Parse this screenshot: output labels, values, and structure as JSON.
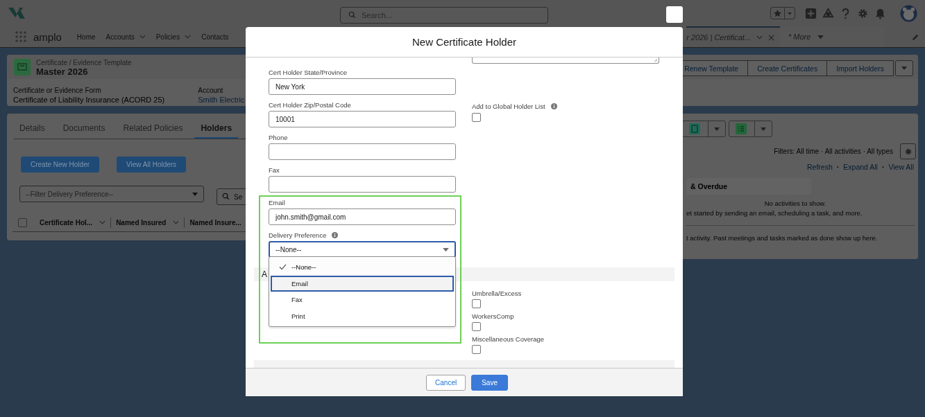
{
  "global_header": {
    "search_placeholder": "Search..."
  },
  "app_nav": {
    "app_name": "amplo",
    "items": [
      {
        "label": "Home",
        "has_menu": false
      },
      {
        "label": "Accounts",
        "has_menu": true
      },
      {
        "label": "Policies",
        "has_menu": true
      },
      {
        "label": "Contacts",
        "has_menu": false
      }
    ],
    "open_tab": "r 2026 | Certificat...",
    "more": "* More"
  },
  "record": {
    "object_type": "Certificate / Evidence Template",
    "title": "Master 2026",
    "fields": [
      {
        "label": "Certificate or Evidence Form",
        "value": "Certificate of Liability Insurance (ACORD 25)",
        "kind": "text"
      },
      {
        "label": "Account",
        "value": "Smith Electric",
        "kind": "link"
      }
    ],
    "actions": [
      "Renew Template",
      "Create Certificates",
      "Import Holders"
    ]
  },
  "tabs": [
    {
      "label": "Details",
      "selected": false
    },
    {
      "label": "Documents",
      "selected": false
    },
    {
      "label": "Related Policies",
      "selected": false
    },
    {
      "label": "Holders",
      "selected": true
    }
  ],
  "holders": {
    "buttons": [
      "Create New Holder",
      "View All Holders"
    ],
    "filter": "--Filter Delivery Preference--",
    "search_placeholder": "Se",
    "select_all_checked": false,
    "columns": [
      {
        "label": "Certificate Hol...",
        "has_menu": true
      },
      {
        "label": "Named Insured",
        "has_menu": true
      },
      {
        "label": "Named Insure...",
        "has_menu": false
      }
    ]
  },
  "activity": {
    "filters": "Filters: All time · All activities · All types",
    "links": [
      "Refresh",
      "Expand All",
      "View All"
    ],
    "separator": "·",
    "section": "& Overdue",
    "empty_title": "No activities to show.",
    "empty_hint": "et started by sending an email, scheduling a task, and more.",
    "past_hint": "t activity. Past meetings and tasks marked as done show up here."
  },
  "modal": {
    "title": "New Certificate Holder",
    "fields": [
      {
        "label": "Cert Holder State/Province",
        "value": "New York"
      },
      {
        "label": "Cert Holder Zip/Postal Code",
        "value": "10001"
      },
      {
        "label": "Phone"
      },
      {
        "label": "Fax"
      }
    ],
    "email": {
      "label": "Email",
      "value": "john.smith@gmail.com"
    },
    "delivery": {
      "label": "Delivery Preference",
      "value": "--None--",
      "open": true,
      "highlighted": true,
      "options": [
        {
          "label": "--None--",
          "selected": true,
          "focused": false
        },
        {
          "label": "Email",
          "selected": false,
          "focused": true
        },
        {
          "label": "Fax",
          "selected": false,
          "focused": false
        },
        {
          "label": "Print",
          "selected": false,
          "focused": false
        }
      ]
    },
    "global_holder": {
      "label": "Add to Global Holder List",
      "checked": false
    },
    "section": "A",
    "coverages": [
      {
        "label": "Umbrella/Excess",
        "checked": false
      },
      {
        "label": "WorkersComp",
        "checked": false
      },
      {
        "label": "Miscellaneous Coverage",
        "checked": false
      }
    ],
    "buttons": [
      {
        "label": "Cancel",
        "kind": "neutral"
      },
      {
        "label": "Save",
        "kind": "brand"
      }
    ]
  }
}
